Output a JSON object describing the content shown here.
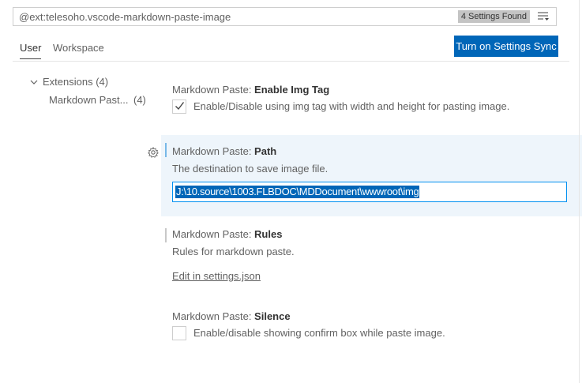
{
  "search": {
    "value": "@ext:telesoho.vscode-markdown-paste-image",
    "badge": "4 Settings Found"
  },
  "tabs": [
    {
      "label": "User",
      "active": true
    },
    {
      "label": "Workspace",
      "active": false
    }
  ],
  "sync_button": {
    "label": "Turn on Settings Sync"
  },
  "tree": {
    "extensions": {
      "label": "Extensions",
      "count": "(4)"
    },
    "markdown": {
      "label": "Markdown Past...",
      "count": "(4)"
    }
  },
  "settings": {
    "img_tag": {
      "prefix": "Markdown Paste: ",
      "name": "Enable Img Tag",
      "description": "Enable/Disable using img tag with width and height for pasting image.",
      "checked": true
    },
    "path": {
      "prefix": "Markdown Paste: ",
      "name": "Path",
      "description": "The destination to save image file.",
      "value": "J:\\10.source\\1003.FLBDOC\\MDDocument\\wwwroot\\img"
    },
    "rules": {
      "prefix": "Markdown Paste: ",
      "name": "Rules",
      "description": "Rules for markdown paste.",
      "link": "Edit in settings.json"
    },
    "silence": {
      "prefix": "Markdown Paste: ",
      "name": "Silence",
      "description": "Enable/disable showing confirm box while paste image.",
      "checked": false
    }
  },
  "colors": {
    "accent": "#0066b8",
    "focus_border": "#0090f1",
    "focus_bg": "#eef5fb"
  }
}
